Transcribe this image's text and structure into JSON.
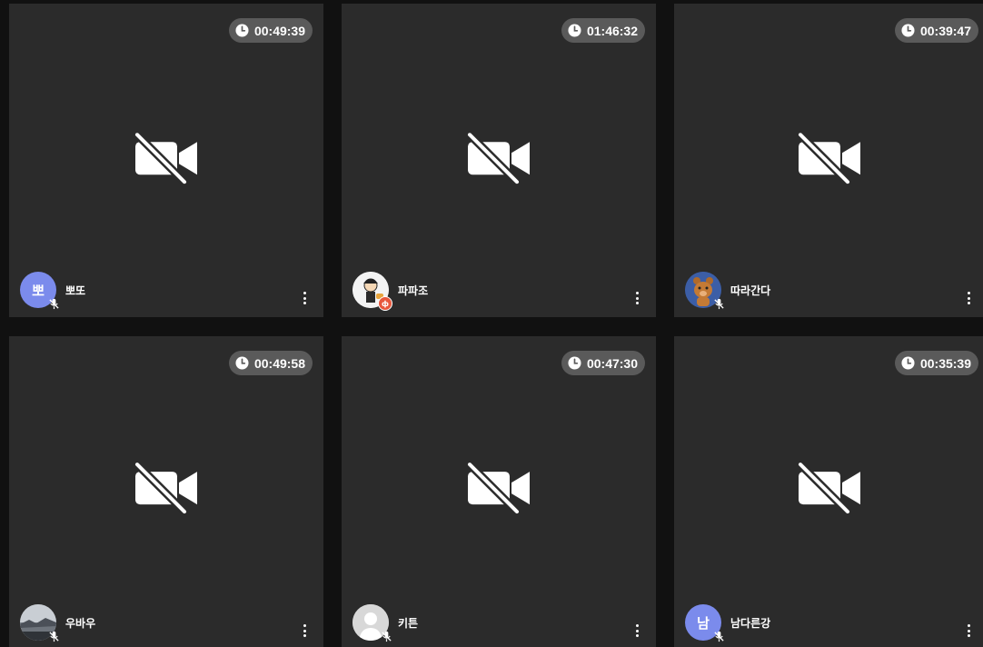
{
  "tiles": [
    {
      "name": "뽀또",
      "timer": "00:49:39",
      "avatar_text": "뽀",
      "avatar_kind": "initial",
      "avatar_color": "#7b8bec",
      "badge": "mic-off"
    },
    {
      "name": "파파조",
      "timer": "01:46:32",
      "avatar_text": "",
      "avatar_kind": "cartoon-photo",
      "avatar_color": "#f3f3f3",
      "badge": "host",
      "badge_text": "ф"
    },
    {
      "name": "따라간다",
      "timer": "00:39:47",
      "avatar_text": "",
      "avatar_kind": "bear-photo",
      "avatar_color": "#3c5ea6",
      "badge": "mic-off"
    },
    {
      "name": "우바우",
      "timer": "00:49:58",
      "avatar_text": "",
      "avatar_kind": "landscape-photo",
      "avatar_color": "#8a8f96",
      "badge": "mic-off"
    },
    {
      "name": "키튼",
      "timer": "00:47:30",
      "avatar_text": "",
      "avatar_kind": "default-silhouette",
      "avatar_color": "#d8d8d8",
      "badge": "mic-off"
    },
    {
      "name": "남다른강",
      "timer": "00:35:39",
      "avatar_text": "남",
      "avatar_kind": "initial",
      "avatar_color": "#7b8bec",
      "badge": "mic-off"
    }
  ],
  "icons": {
    "timer": "clock-icon",
    "video": "video-off-icon",
    "mic": "mic-off-icon",
    "menu": "more-vertical-icon"
  },
  "colors": {
    "background": "#111111",
    "tile": "#2b2b2b",
    "timer_pill": "#5a5a5a"
  }
}
